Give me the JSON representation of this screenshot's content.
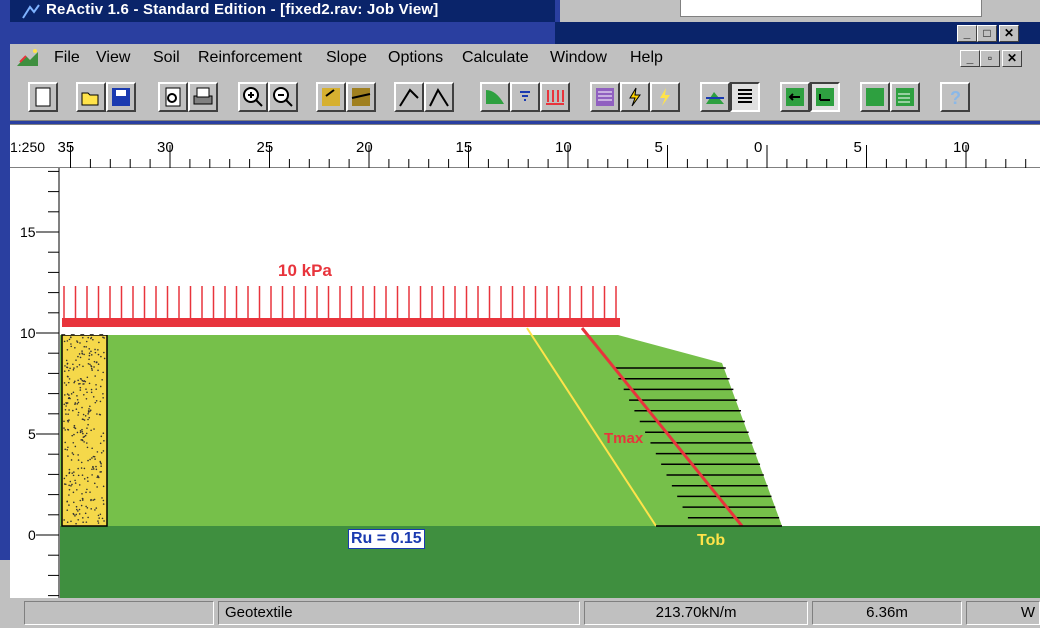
{
  "window": {
    "title": "ReActiv 1.6 - Standard Edition - [fixed2.rav: Job View]",
    "app_icon": "reactiv-app-icon"
  },
  "menu": [
    "File",
    "View",
    "Soil",
    "Reinforcement",
    "Slope",
    "Options",
    "Calculate",
    "Window",
    "Help"
  ],
  "toolbar": {
    "buttons": [
      "new-icon",
      "open-icon",
      "save-icon",
      "print-preview-icon",
      "print-icon",
      "zoom-in-icon",
      "zoom-out-icon",
      "soil-layer-icon",
      "soil-edit-icon",
      "slope-draw-icon",
      "slope-line-icon",
      "slope-surface-icon",
      "water-table-icon",
      "surcharge-icon",
      "reinforcement-icon",
      "calc-bolt-icon",
      "calc-run-icon",
      "view-profile-icon",
      "view-layers-icon",
      "view-left-icon",
      "view-right-icon",
      "view-fill-icon",
      "view-grid-icon",
      "help-icon"
    ]
  },
  "ruler": {
    "scale": "1:250",
    "labels": [
      "35",
      "30",
      "25",
      "20",
      "15",
      "10",
      "5",
      "0",
      "5",
      "10"
    ]
  },
  "vruler": {
    "labels": [
      "15",
      "10",
      "5",
      "0"
    ]
  },
  "canvas": {
    "surcharge_label": "10 kPa",
    "ru_label": "Ru = 0.15",
    "tmax_label": "Tmax",
    "tob_label": "Tob"
  },
  "status": {
    "cells": [
      "",
      "Geotextile",
      "213.70kN/m",
      "6.36m",
      "W"
    ]
  },
  "colors": {
    "soil": "#76c04a",
    "foundation": "#3f8f3f",
    "surcharge": "#e8343c",
    "reinforcement": "#000000",
    "slip_tob": "#ffe34a",
    "slip_tmax": "#e8343c"
  }
}
